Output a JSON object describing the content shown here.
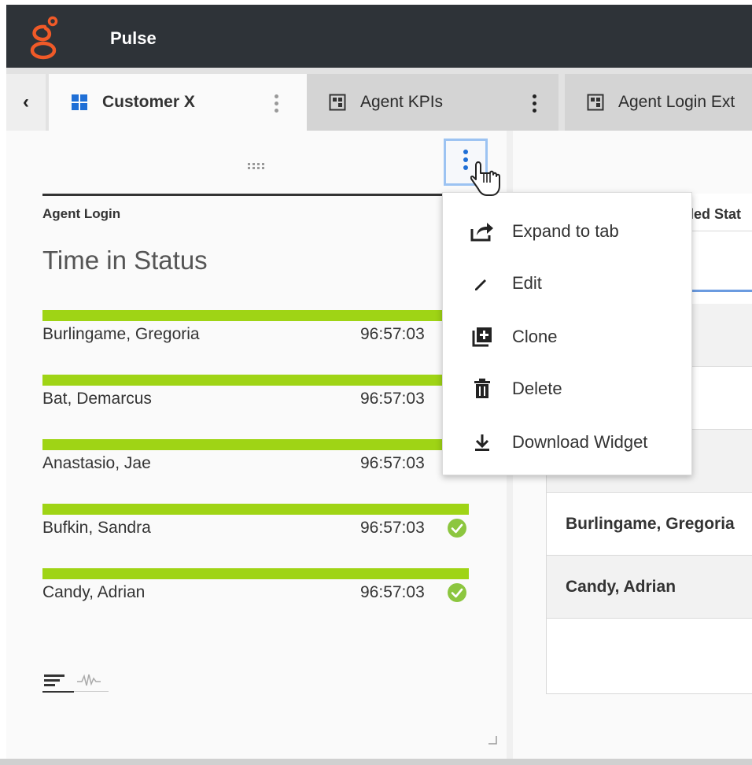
{
  "app": {
    "title": "Pulse"
  },
  "tabs": [
    {
      "label": "Customer X",
      "active": true,
      "icon": "dashboard-grid-icon"
    },
    {
      "label": "Agent KPIs",
      "active": false,
      "icon": "widget-layout-icon"
    },
    {
      "label": "Agent Login Ext",
      "active": false,
      "icon": "widget-layout-icon"
    }
  ],
  "widget": {
    "kicker": "Agent Login",
    "title": "Time in Status",
    "rows": [
      {
        "name": "Burlingame, Gregoria",
        "time": "96:57:03",
        "level": 1.0
      },
      {
        "name": "Bat, Demarcus",
        "time": "96:57:03",
        "level": 1.0
      },
      {
        "name": "Anastasio, Jae",
        "time": "96:57:03",
        "level": 1.0
      },
      {
        "name": "Bufkin, Sandra",
        "time": "96:57:03",
        "level": 1.0,
        "status_icon": "check-circle-icon"
      },
      {
        "name": "Candy, Adrian",
        "time": "96:57:03",
        "level": 1.0,
        "status_icon": "check-circle-icon"
      }
    ]
  },
  "right_panel": {
    "header": "led Stat",
    "rows": [
      "Burlingame, Gregoria",
      "Candy, Adrian"
    ]
  },
  "menu": {
    "items": [
      {
        "label": "Expand to tab",
        "icon": "expand-to-tab-icon"
      },
      {
        "label": "Edit",
        "icon": "pencil-icon"
      },
      {
        "label": "Clone",
        "icon": "clone-icon"
      },
      {
        "label": "Delete",
        "icon": "trash-icon"
      },
      {
        "label": "Download Widget",
        "icon": "download-icon"
      }
    ]
  },
  "colors": {
    "topbar": "#2e3338",
    "brand": "#f05a28",
    "bar": "#9fd415",
    "accent_blue": "#1f6fd6",
    "check": "#8cc63f"
  }
}
